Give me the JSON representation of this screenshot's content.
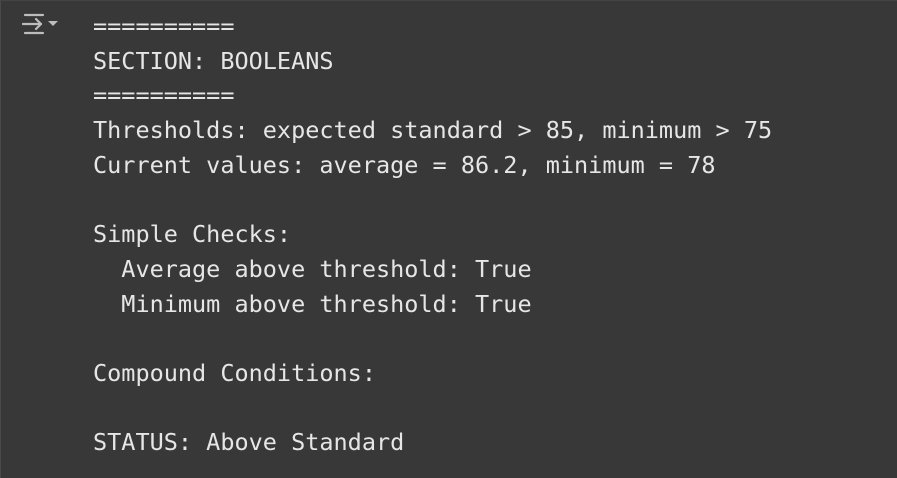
{
  "toolbar": {
    "output_menu_icon": "clear-output-icon",
    "icon_color": "#bdbdbd"
  },
  "output": {
    "lines": [
      "==========",
      "SECTION: BOOLEANS",
      "==========",
      "Thresholds: expected standard > 85, minimum > 75",
      "Current values: average = 86.2, minimum = 78",
      "",
      "Simple Checks:",
      "  Average above threshold: True",
      "  Minimum above threshold: True",
      "",
      "Compound Conditions:",
      "",
      "STATUS: Above Standard"
    ]
  },
  "colors": {
    "background": "#383838",
    "text": "#e6e6e6"
  }
}
